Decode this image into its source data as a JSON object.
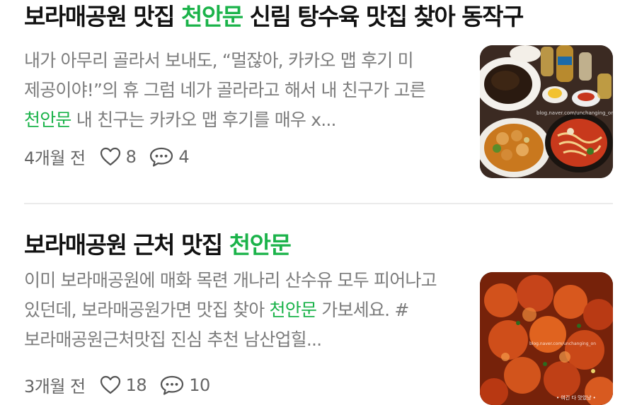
{
  "posts": [
    {
      "title_pre": "보라매공원 맛집 ",
      "title_highlight": "천안문",
      "title_post": " 신림 탕수육 맛집 찾아 동작구",
      "desc_pre": "내가 아무리 골라서 보내도, “멀잖아, 카카오 맵 후기 미 제공이야!”의 휴 그럼 네가 골라라고 해서 내 친구가 고른 ",
      "desc_highlight": "천안문",
      "desc_post": " 내 친구는 카카오 맵 후기를 매우 x...",
      "time": "4개월 전",
      "likes": "8",
      "comments": "4",
      "thumb_watermark": "blog.naver.com/unchanging_on"
    },
    {
      "title_pre": "보라매공원 근처 맛집 ",
      "title_highlight": "천안문",
      "title_post": "",
      "desc_pre": "이미 보라매공원에 매화 목련 개나리 산수유 모두 피어나고 있던데, 보라매공원가면 맛집 찾아 ",
      "desc_highlight": "천안문",
      "desc_post": " 가보세요. #보라매공원근처맛집 진심 추천 남산업힐...",
      "time": "3개월 전",
      "likes": "18",
      "comments": "10",
      "thumb_watermark": "blog.naver.com/unchanging_on",
      "thumb_caption": "• 여긴 다 맛있냥 •"
    }
  ],
  "icons": {
    "like": "heart-outline-icon",
    "comment": "speech-bubble-icon"
  },
  "colors": {
    "highlight": "#1bb34a",
    "meta": "#666666",
    "desc": "#7c7c7c"
  }
}
